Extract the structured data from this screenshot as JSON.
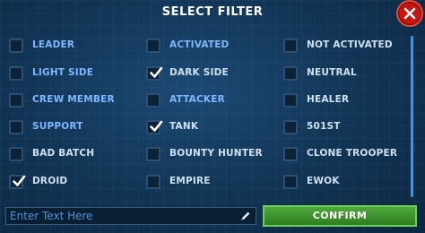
{
  "dialog": {
    "title": "SELECT FILTER",
    "close_icon": "close-icon"
  },
  "filters": [
    [
      {
        "label": "LEADER",
        "checked": false,
        "color": "blue"
      },
      {
        "label": "ACTIVATED",
        "checked": false,
        "color": "blue"
      },
      {
        "label": "NOT ACTIVATED",
        "checked": false,
        "color": "white"
      }
    ],
    [
      {
        "label": "LIGHT SIDE",
        "checked": false,
        "color": "blue"
      },
      {
        "label": "DARK SIDE",
        "checked": true,
        "color": "white"
      },
      {
        "label": "NEUTRAL",
        "checked": false,
        "color": "white"
      }
    ],
    [
      {
        "label": "CREW MEMBER",
        "checked": false,
        "color": "blue"
      },
      {
        "label": "ATTACKER",
        "checked": false,
        "color": "blue"
      },
      {
        "label": "HEALER",
        "checked": false,
        "color": "white"
      }
    ],
    [
      {
        "label": "SUPPORT",
        "checked": false,
        "color": "blue"
      },
      {
        "label": "TANK",
        "checked": true,
        "color": "white"
      },
      {
        "label": "501ST",
        "checked": false,
        "color": "white"
      }
    ],
    [
      {
        "label": "BAD BATCH",
        "checked": false,
        "color": "white"
      },
      {
        "label": "BOUNTY HUNTER",
        "checked": false,
        "color": "white"
      },
      {
        "label": "CLONE TROOPER",
        "checked": false,
        "color": "white"
      }
    ],
    [
      {
        "label": "DROID",
        "checked": true,
        "color": "white"
      },
      {
        "label": "EMPIRE",
        "checked": false,
        "color": "white"
      },
      {
        "label": "EWOK",
        "checked": false,
        "color": "white"
      }
    ]
  ],
  "search": {
    "placeholder": "Enter Text Here",
    "value": "",
    "icon": "pencil-icon"
  },
  "confirm_label": "CONFIRM",
  "colors": {
    "background": "#133758",
    "label_blue": "#7fb6ff",
    "label_white": "#cfe0ef",
    "confirm_green": "#3d9430",
    "close_red": "#c9140f"
  }
}
